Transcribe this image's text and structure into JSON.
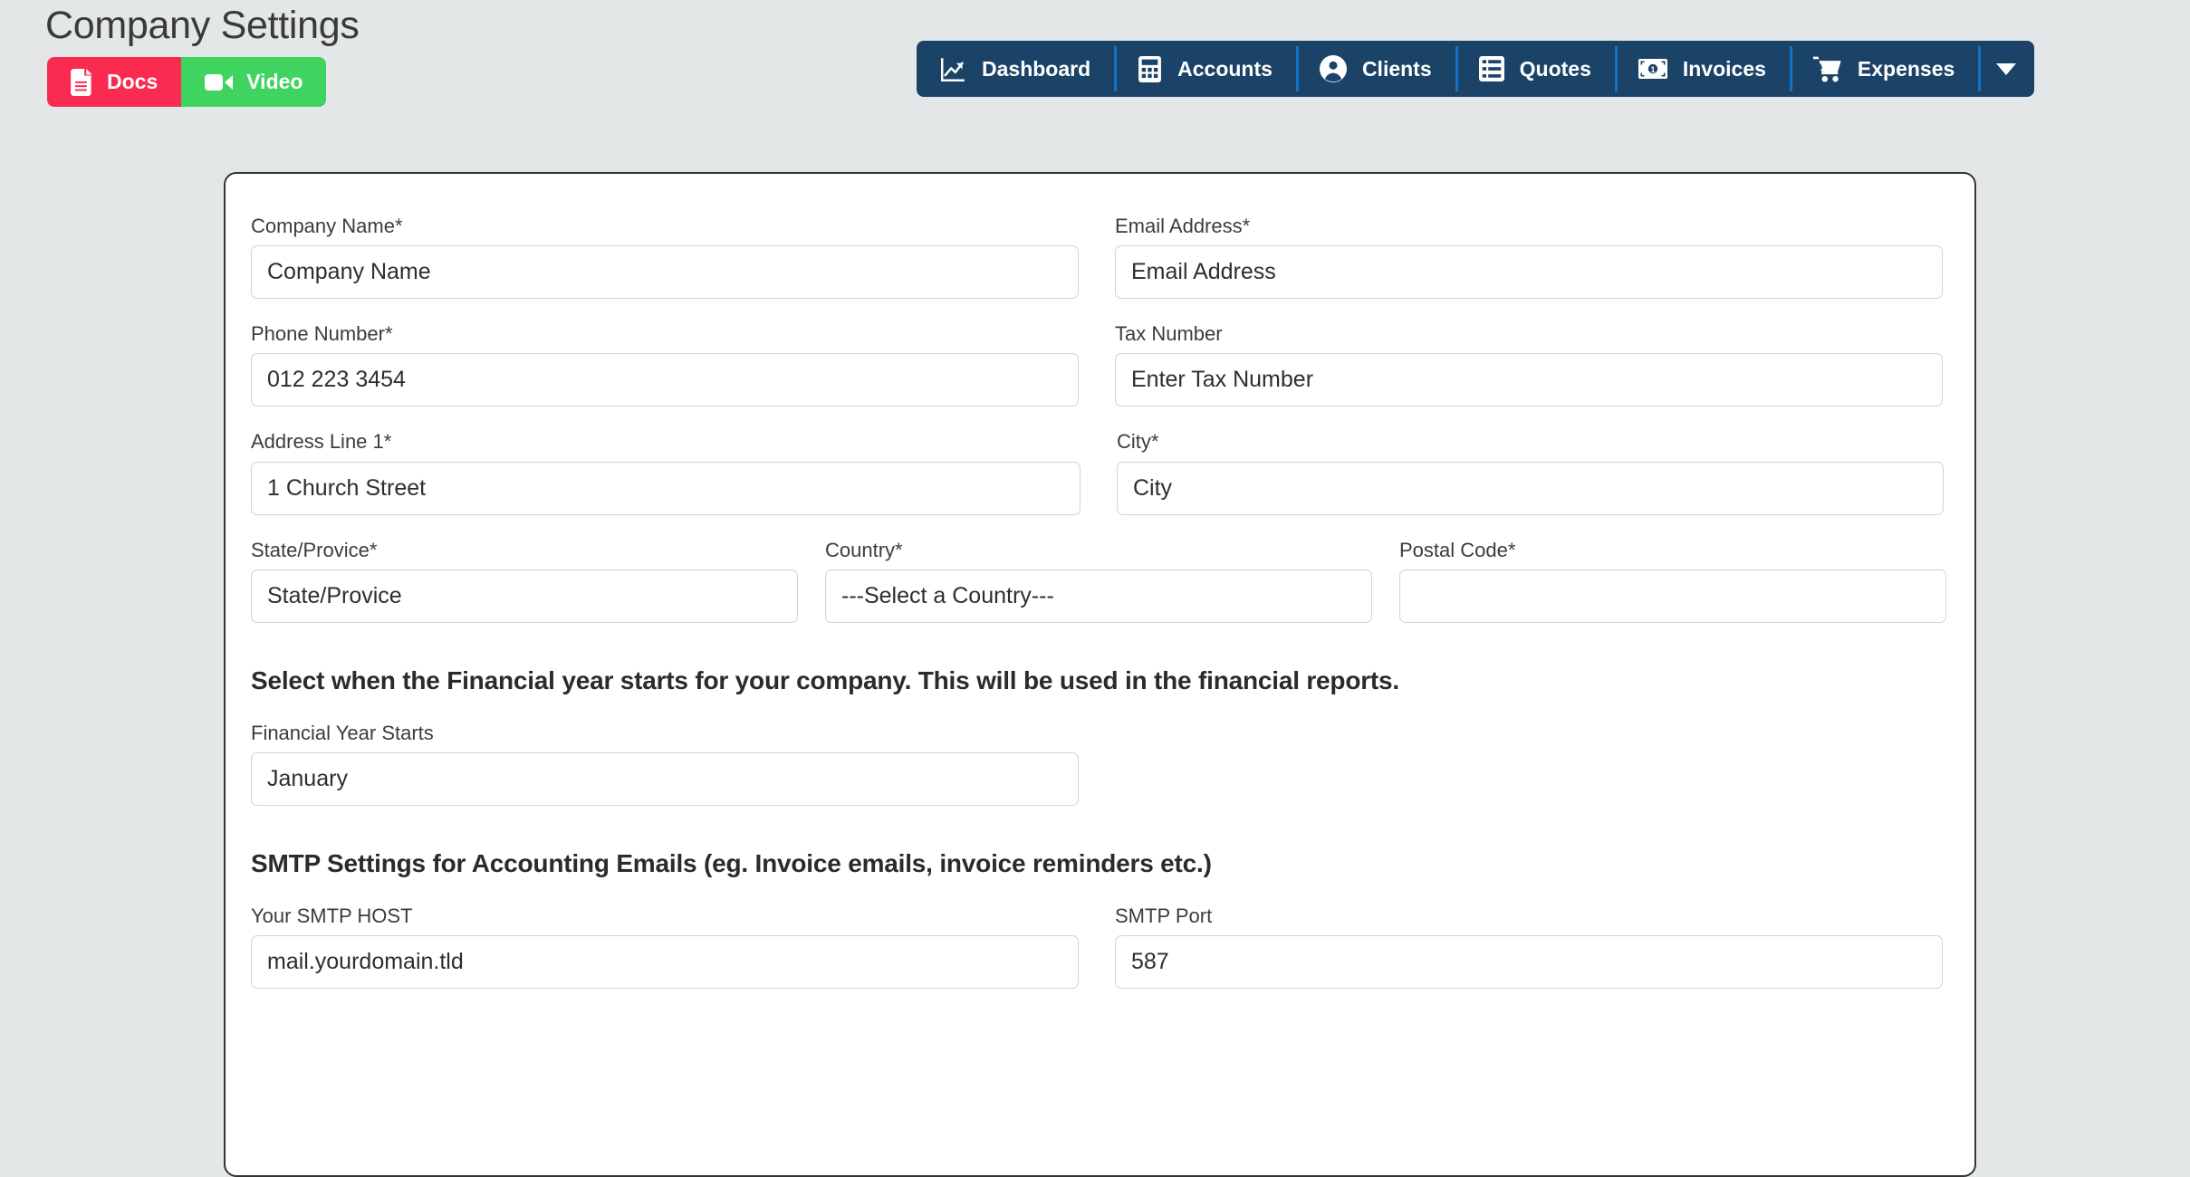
{
  "header": {
    "title": "Company Settings",
    "buttons": [
      {
        "label": "Docs",
        "icon": "file-lines-icon",
        "color": "#fa2a50"
      },
      {
        "label": "Video",
        "icon": "video-camera-icon",
        "color": "#3ed45f"
      }
    ]
  },
  "nav": {
    "background": "#1b4368",
    "divider_color": "#1573c7",
    "items": [
      {
        "label": "Dashboard",
        "icon": "chart-line-icon"
      },
      {
        "label": "Accounts",
        "icon": "calculator-icon"
      },
      {
        "label": "Clients",
        "icon": "user-circle-icon"
      },
      {
        "label": "Quotes",
        "icon": "list-box-icon"
      },
      {
        "label": "Invoices",
        "icon": "money-bill-icon"
      },
      {
        "label": "Expenses",
        "icon": "shopping-cart-icon"
      }
    ],
    "caret": {
      "icon": "chevron-down-icon"
    }
  },
  "form": {
    "row1": [
      {
        "label": "Company Name*",
        "value": "Company Name",
        "placeholder": "Company Name"
      },
      {
        "label": "Email Address*",
        "value": "Email Address",
        "placeholder": "Email Address"
      }
    ],
    "row2": [
      {
        "label": "Phone Number*",
        "value": "012 223 3454",
        "placeholder": "Phone Number"
      },
      {
        "label": "Tax Number",
        "value": "Enter Tax Number",
        "placeholder": "Enter Tax Number"
      }
    ],
    "row3": [
      {
        "label": "Address Line 1*",
        "value": "1 Church Street",
        "placeholder": "Address Line 1"
      },
      {
        "label": "City*",
        "value": "City",
        "placeholder": "City"
      }
    ],
    "row4": [
      {
        "label": "State/Provice*",
        "value": "State/Provice",
        "placeholder": "State/Provice"
      },
      {
        "label": "Country*",
        "value": "---Select a Country---",
        "placeholder": "---Select a Country---"
      },
      {
        "label": "Postal Code*",
        "value": "",
        "placeholder": ""
      }
    ],
    "financial": {
      "heading": "Select when the Financial year starts for your company. This will be used in the financial reports.",
      "label": "Financial Year Starts",
      "value": "January"
    },
    "smtp": {
      "heading": "SMTP Settings for Accounting Emails (eg. Invoice emails, invoice reminders etc.)",
      "host": {
        "label": "Your SMTP HOST",
        "value": "mail.yourdomain.tld",
        "placeholder": "mail.yourdomain.tld"
      },
      "port": {
        "label": "SMTP Port",
        "value": "587",
        "placeholder": "587"
      }
    }
  }
}
